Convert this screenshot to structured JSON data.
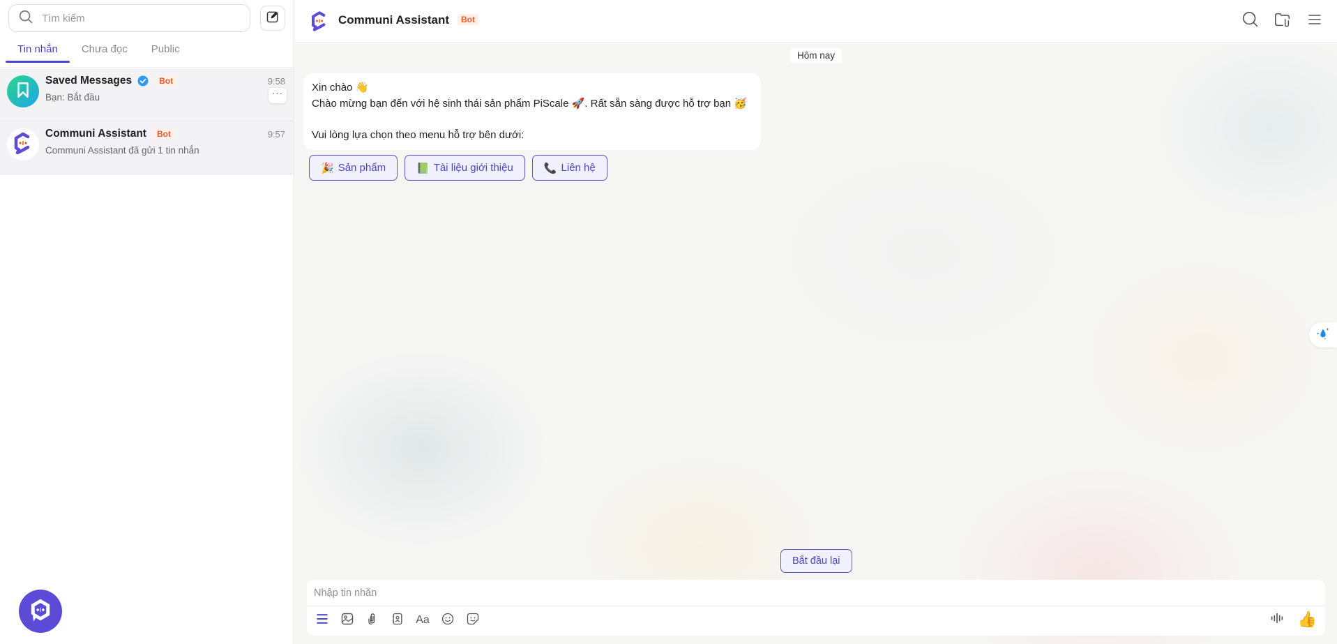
{
  "sidebar": {
    "search": {
      "placeholder": "Tìm kiếm",
      "value": ""
    },
    "compose_icon": "compose-icon",
    "tabs": [
      {
        "label": "Tin nhắn",
        "active": true
      },
      {
        "label": "Chưa đọc",
        "active": false
      },
      {
        "label": "Public",
        "active": false
      }
    ],
    "conversations": [
      {
        "name": "Saved Messages",
        "verified": true,
        "badge": "Bot",
        "preview": "Bạn: Bắt đầu",
        "time": "9:58",
        "more_label": "···",
        "avatar_icon": "bookmark-icon"
      },
      {
        "name": "Communi Assistant",
        "verified": false,
        "badge": "Bot",
        "preview": "Communi Assistant đã gửi 1 tin nhắn",
        "time": "9:57",
        "avatar_icon": "communi-logo-icon"
      }
    ],
    "app_logo_icon": "communi-app-logo"
  },
  "header": {
    "title": "Communi Assistant",
    "badge": "Bot",
    "icons": [
      "search-icon",
      "folder-attachment-icon",
      "menu-icon"
    ]
  },
  "chat": {
    "day_label": "Hôm nay",
    "message": {
      "lines": [
        "Xin chào 👋",
        "Chào mừng bạn đến với hệ sinh thái sản phẩm PiScale 🚀. Rất sẵn sàng được hỗ trợ bạn 🥳",
        "",
        "Vui lòng lựa chọn theo menu hỗ trợ bên dưới:"
      ]
    },
    "quick_replies": [
      {
        "emoji": "🎉",
        "label": "Sản phẩm"
      },
      {
        "emoji": "📗",
        "label": "Tài liệu giới thiệu"
      },
      {
        "emoji": "📞",
        "label": "Liên hệ"
      }
    ],
    "restart_label": "Bắt đầu lại"
  },
  "composer": {
    "placeholder": "Nhập tin nhắn",
    "value": "",
    "font_tool_label": "Aa",
    "thumb_emoji": "👍"
  },
  "colors": {
    "accent": "#4b44c6",
    "bot_badge": "#f05a28",
    "brand_purple": "#5b4bd6"
  }
}
